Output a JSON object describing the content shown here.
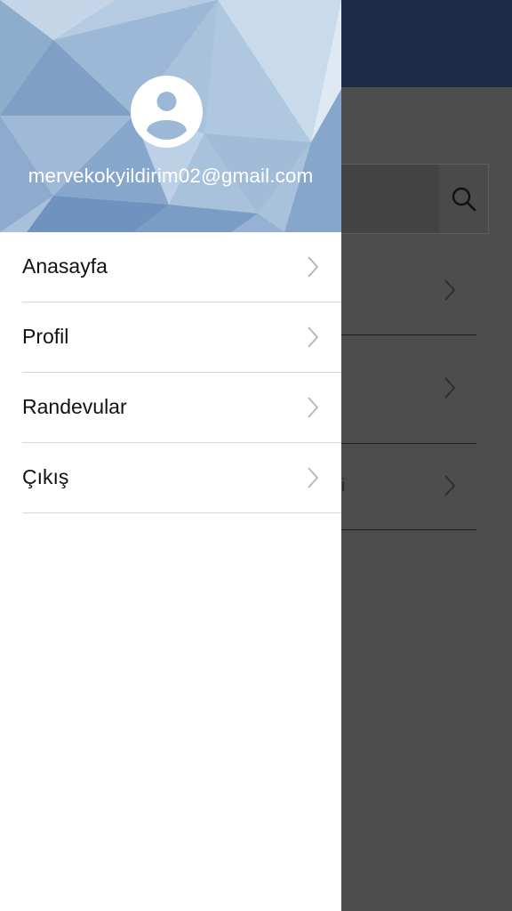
{
  "drawer": {
    "user_email": "mervekokyildirim02@gmail.com",
    "avatar_icon": "user-avatar-icon",
    "header_colors": [
      "#a9c2dc",
      "#8aa9cb",
      "#c3d5e8",
      "#6b8fbc",
      "#dbe6f1"
    ],
    "menu": [
      {
        "label": "Anasayfa",
        "icon": "chevron-right-icon"
      },
      {
        "label": "Profil",
        "icon": "chevron-right-icon"
      },
      {
        "label": "Randevular",
        "icon": "chevron-right-icon"
      },
      {
        "label": "Çıkış",
        "icon": "chevron-right-icon"
      }
    ]
  },
  "background_page": {
    "header_color": "#1c2b46",
    "overlay_color": "#4d4d4d",
    "search_icon": "search-icon",
    "partial_row_text": "i"
  }
}
